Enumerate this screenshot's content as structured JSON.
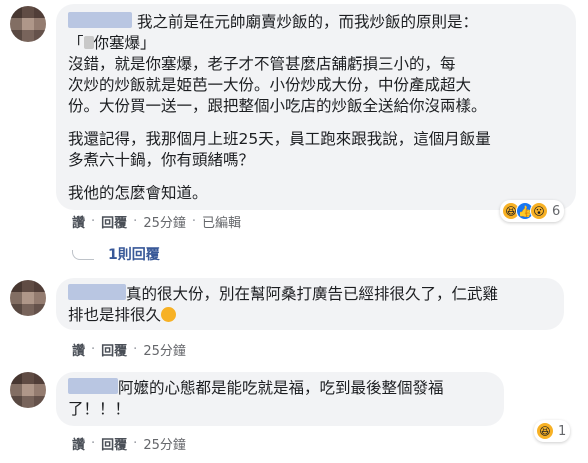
{
  "comments": [
    {
      "lines": [
        "我之前是在元帥廟賣炒飯的，而我炒飯的原則是：",
        "你塞爆」",
        "沒錯，就是你塞爆，老子才不管甚麼店舖虧損三小的，每",
        "次炒的炒飯就是姫芭一大份。小份炒成大份，中份產成超大",
        "份。大份買一送一，跟把整個小吃店的炒飯全送給你沒兩樣。",
        "我還記得，我那個月上班25天，員工跑來跟我說，這個月飯量",
        "多煮六十鍋，你有頭緒嗎？",
        "我他的怎麼會知道。"
      ],
      "quote_open": "「",
      "actions": {
        "like": "讚",
        "reply": "回覆",
        "time": "25分鐘",
        "edited": "已編輯"
      },
      "reactions": {
        "icons": [
          "haha-icon",
          "like-icon",
          "wow-icon"
        ],
        "count": "6"
      }
    },
    {
      "lines": [
        "真的很大份，別在幫阿桑打廣告已經排很久了，仁武雞",
        "排也是排很久"
      ],
      "actions": {
        "like": "讚",
        "reply": "回覆",
        "time": "25分鐘"
      }
    },
    {
      "lines": [
        "阿嬤的心態都是能吃就是福，吃到最後整個發福",
        "了！！！"
      ],
      "actions": {
        "like": "讚",
        "reply": "回覆",
        "time": "25分鐘"
      },
      "reactions": {
        "icons": [
          "haha-icon"
        ],
        "count": "1"
      }
    }
  ],
  "replies_link": "1則回覆",
  "colors": {
    "bubble": "#f2f3f5",
    "link": "#385898",
    "like": "#1877f2",
    "haha": "#f7b125"
  }
}
